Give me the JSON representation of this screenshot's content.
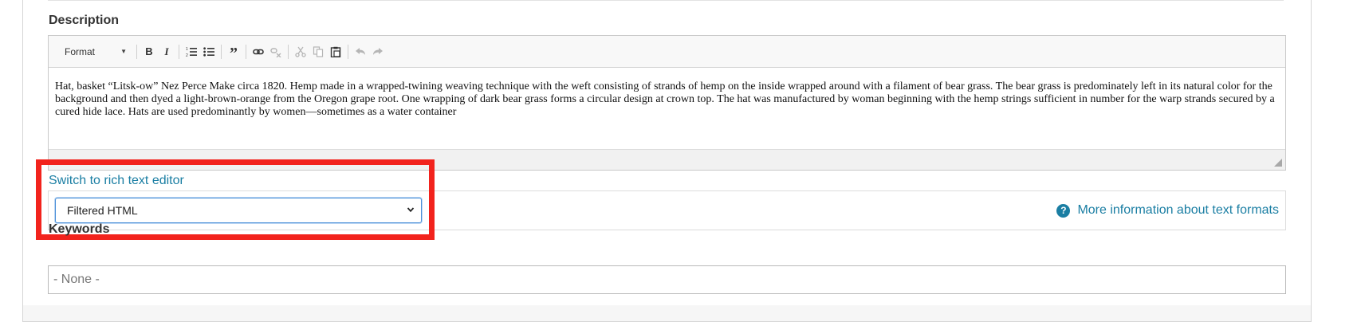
{
  "description": {
    "label": "Description",
    "toolbar": {
      "format_label": "Format",
      "buttons": [
        "bold",
        "italic",
        "numbered-list",
        "bulleted-list",
        "blockquote",
        "link",
        "unlink",
        "cut",
        "copy",
        "paste",
        "undo",
        "redo"
      ]
    },
    "body_text": "Hat, basket “Litsk-ow” Nez Perce Make circa 1820. Hemp made in a wrapped-twining weaving technique with the weft consisting of strands of hemp on the inside wrapped around with a filament of bear grass. The bear grass is predominately left in its natural color for the background and then dyed a light-brown-orange from the Oregon grape root. One wrapping of dark bear grass forms a circular design at crown top. The hat was manufactured by woman beginning with the hemp strings sufficient in number for the warp strands secured by a cured hide lace. Hats are used predominantly by women—sometimes as a water container"
  },
  "text_format": {
    "switch_link": "Switch to rich text editor",
    "selected": "Filtered HTML",
    "more_info": "More information about text formats",
    "help_icon_glyph": "?"
  },
  "keywords": {
    "label": "Keywords",
    "placeholder": "- None -"
  },
  "colors": {
    "link": "#1a7ea3",
    "highlight": "#f2231d",
    "focus": "#4a8fd8"
  }
}
